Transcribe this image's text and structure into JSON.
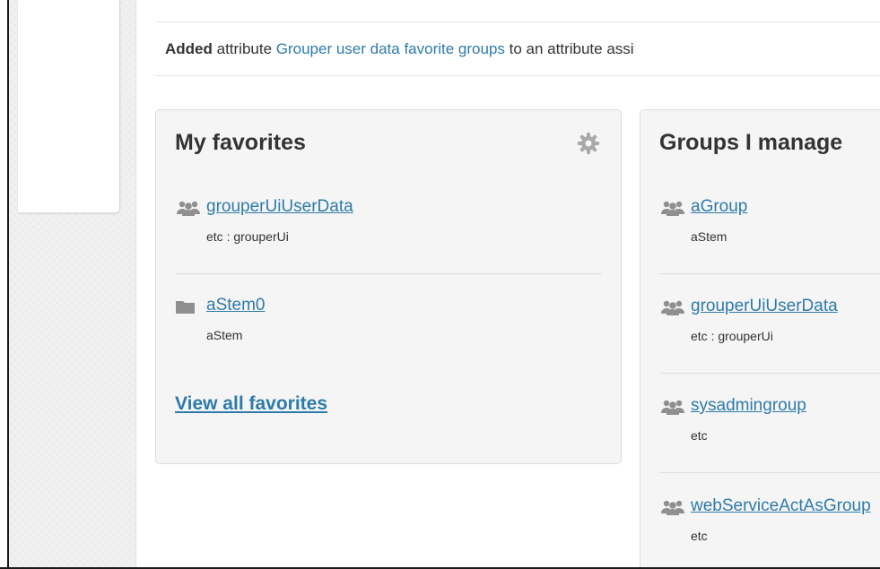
{
  "notice": {
    "bold": "Added",
    "pre": " attribute ",
    "link": "Grouper user data favorite groups",
    "post": " to an attribute assi"
  },
  "favorites": {
    "title": "My favorites",
    "items": [
      {
        "icon": "group-icon",
        "name": "grouperUiUserData",
        "path": "etc : grouperUi"
      },
      {
        "icon": "folder-icon",
        "name": "aStem0",
        "path": "aStem"
      }
    ],
    "view_all": "View all favorites"
  },
  "managed": {
    "title": "Groups I manage",
    "items": [
      {
        "icon": "group-icon",
        "name": "aGroup",
        "path": "aStem"
      },
      {
        "icon": "group-icon",
        "name": "grouperUiUserData",
        "path": "etc : grouperUi"
      },
      {
        "icon": "group-icon",
        "name": "sysadmingroup",
        "path": "etc"
      },
      {
        "icon": "group-icon",
        "name": "webServiceActAsGroup",
        "path": "etc"
      }
    ]
  },
  "colors": {
    "link": "#2e7bab",
    "text": "#333333",
    "panel": "#f5f5f5"
  }
}
